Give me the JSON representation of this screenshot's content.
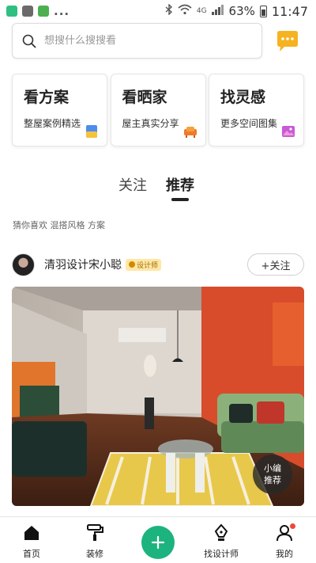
{
  "status_bar": {
    "network": "4G",
    "battery": "63%",
    "time": "11:47",
    "dots": "..."
  },
  "search": {
    "placeholder": "想搜什么搜搜看"
  },
  "categories": [
    {
      "title": "看方案",
      "subtitle": "整屋案例精选",
      "icon": "case-icon"
    },
    {
      "title": "看晒家",
      "subtitle": "屋主真实分享",
      "icon": "sofa-icon"
    },
    {
      "title": "找灵感",
      "subtitle": "更多空间图集",
      "icon": "image-icon"
    }
  ],
  "tabs": [
    {
      "label": "关注",
      "active": false
    },
    {
      "label": "推荐",
      "active": true
    }
  ],
  "tags_line": "猜你喜欢 混搭风格 方案",
  "post": {
    "author": "清羽设计宋小聪",
    "badge": "设计师",
    "follow_label": "+关注",
    "editor_badge": [
      "小编",
      "推荐"
    ]
  },
  "bottom_nav": [
    {
      "label": "首页",
      "icon": "home-icon"
    },
    {
      "label": "装修",
      "icon": "paint-roller-icon"
    },
    {
      "label": "找设计师",
      "icon": "pen-nib-icon"
    },
    {
      "label": "我的",
      "icon": "user-icon",
      "has_dot": true
    }
  ],
  "colors": {
    "accent": "#1db37e",
    "badge_bg": "#ffe7a6",
    "notification_dot": "#f0473c"
  }
}
